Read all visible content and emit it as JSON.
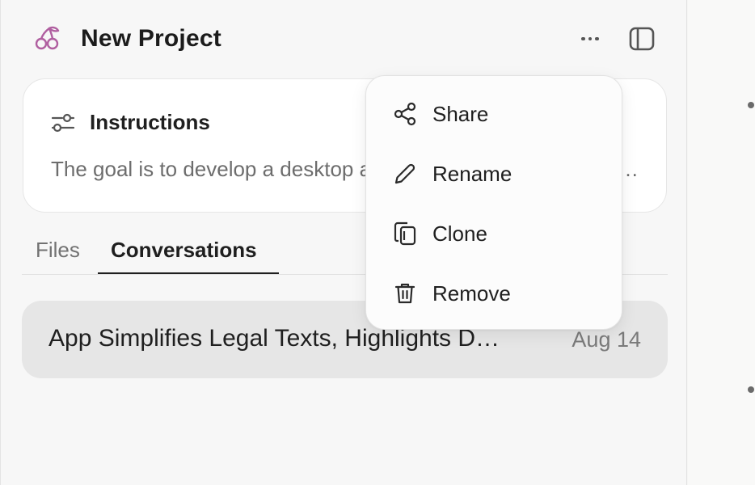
{
  "header": {
    "project_title": "New Project",
    "project_icon": "cherry-icon",
    "accent_color": "#b05fa0"
  },
  "instructions": {
    "title": "Instructions",
    "text": "The goal is to develop a desktop app that simplifies legal documents and highlights key details…"
  },
  "tabs": [
    {
      "label": "Files",
      "active": false
    },
    {
      "label": "Conversations",
      "active": true
    }
  ],
  "conversations": [
    {
      "title": "App Simplifies Legal Texts, Highlights D…",
      "date": "Aug 14"
    }
  ],
  "menu": {
    "items": [
      {
        "label": "Share",
        "icon": "share-icon"
      },
      {
        "label": "Rename",
        "icon": "pencil-icon"
      },
      {
        "label": "Clone",
        "icon": "clone-icon"
      },
      {
        "label": "Remove",
        "icon": "trash-icon"
      }
    ]
  }
}
